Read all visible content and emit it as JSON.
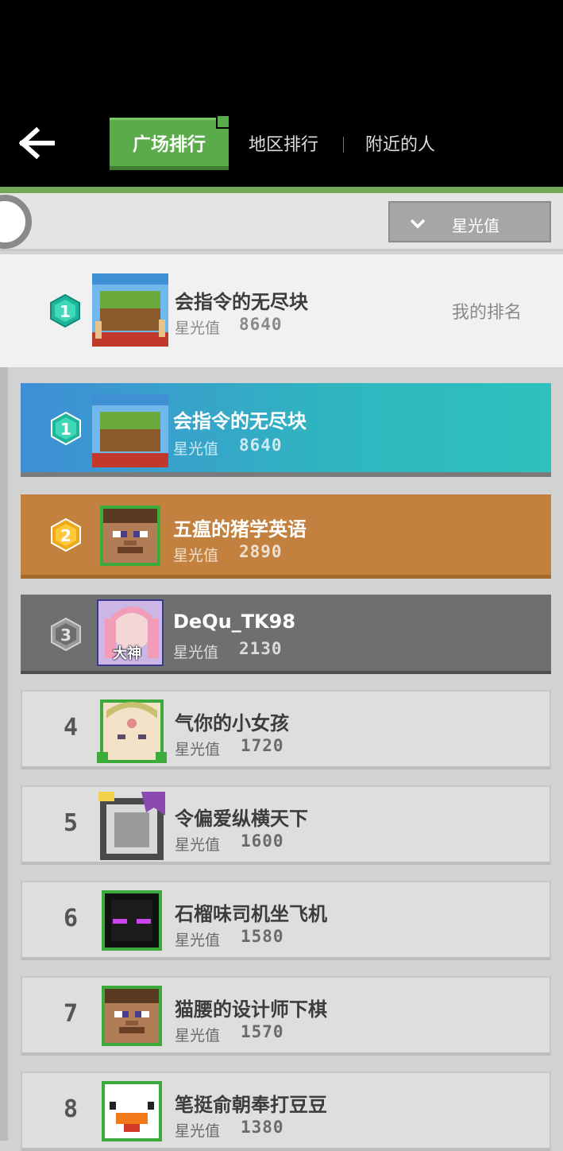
{
  "header": {
    "tabs": [
      {
        "label": "广场排行",
        "active": true
      },
      {
        "label": "地区排行",
        "active": false
      },
      {
        "label": "附近的人",
        "active": false
      }
    ]
  },
  "filter": {
    "selected": "星光值"
  },
  "my_rank": {
    "rank": "1",
    "name": "会指令的无尽块",
    "stat_label": "星光值",
    "stat_value": "8640",
    "label": "我的排名"
  },
  "leaderboard": [
    {
      "rank": "1",
      "name": "会指令的无尽块",
      "stat_label": "星光值",
      "value": "8640"
    },
    {
      "rank": "2",
      "name": "五瘟的猪学英语",
      "stat_label": "星光值",
      "value": "2890"
    },
    {
      "rank": "3",
      "name": "DeQu_TK98",
      "stat_label": "星光值",
      "value": "2130",
      "avatar_badge": "大神"
    },
    {
      "rank": "4",
      "name": "气你的小女孩",
      "stat_label": "星光值",
      "value": "1720"
    },
    {
      "rank": "5",
      "name": "令偏爱纵横天下",
      "stat_label": "星光值",
      "value": "1600"
    },
    {
      "rank": "6",
      "name": "石榴味司机坐飞机",
      "stat_label": "星光值",
      "value": "1580"
    },
    {
      "rank": "7",
      "name": "猫腰的设计师下棋",
      "stat_label": "星光值",
      "value": "1570"
    },
    {
      "rank": "8",
      "name": "笔挺俞朝奉打豆豆",
      "stat_label": "星光值",
      "value": "1380"
    }
  ],
  "colors": {
    "accent_green": "#5aab4a",
    "gold": "#c2813e",
    "teal": "#2fb6bf",
    "silver": "#6f6f6f"
  }
}
